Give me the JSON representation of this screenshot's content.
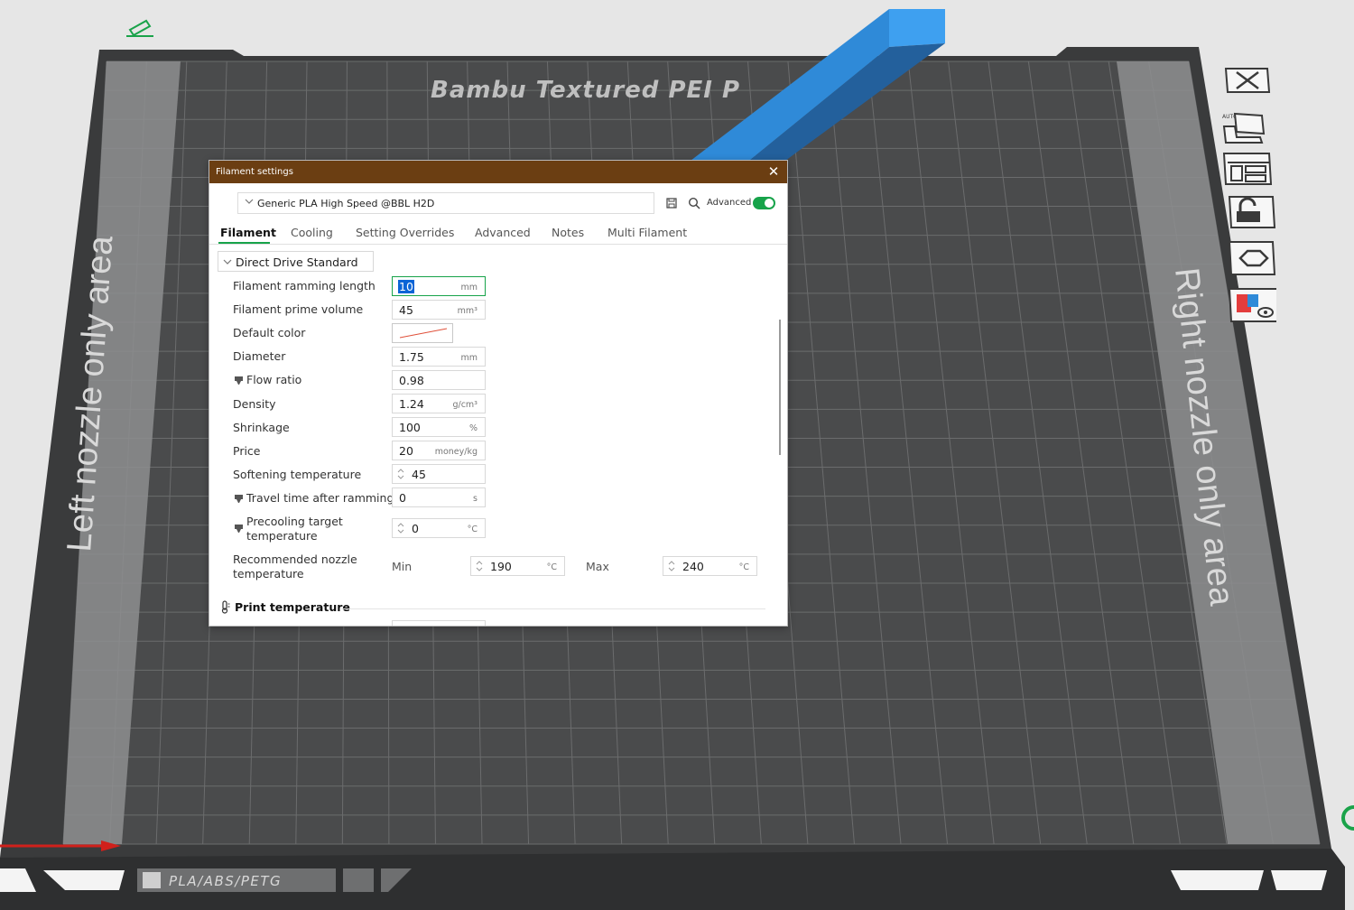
{
  "bed": {
    "plate_name": "Bambu Textured PEI P",
    "left_area_label": "Left nozzle only area",
    "right_area_label": "Right nozzle only area",
    "filament_tag": "PLA/ABS/PETG"
  },
  "side_toolbar": {
    "auto_label": "AUTO",
    "icons": [
      "close-icon",
      "auto-orient-icon",
      "arrange-icon",
      "lock-icon",
      "hexagon-icon",
      "filament-view-icon"
    ]
  },
  "dialog": {
    "title": "Filament settings",
    "preset": "Generic PLA High Speed @BBL H2D",
    "advanced_label": "Advanced",
    "advanced_on": true,
    "tabs": [
      {
        "label": "Filament",
        "active": true
      },
      {
        "label": "Cooling"
      },
      {
        "label": "Setting Overrides"
      },
      {
        "label": "Advanced"
      },
      {
        "label": "Notes"
      },
      {
        "label": "Multi Filament"
      }
    ],
    "group": "Direct Drive Standard",
    "fields": {
      "ramming_length": {
        "label": "Filament ramming length",
        "value": "10",
        "unit": "mm"
      },
      "prime_volume": {
        "label": "Filament prime volume",
        "value": "45",
        "unit": "mm³"
      },
      "default_color": {
        "label": "Default color"
      },
      "diameter": {
        "label": "Diameter",
        "value": "1.75",
        "unit": "mm"
      },
      "flow_ratio": {
        "label": "Flow ratio",
        "value": "0.98"
      },
      "density": {
        "label": "Density",
        "value": "1.24",
        "unit": "g/cm³"
      },
      "shrinkage": {
        "label": "Shrinkage",
        "value": "100",
        "unit": "%"
      },
      "price": {
        "label": "Price",
        "value": "20",
        "unit": "money/kg"
      },
      "softening": {
        "label": "Softening temperature",
        "value": "45"
      },
      "travel_time": {
        "label": "Travel time after ramming",
        "value": "0",
        "unit": "s"
      },
      "precooling": {
        "label1": "Precooling target",
        "label2": "temperature",
        "value": "0",
        "unit": "°C"
      },
      "nozzle_temp": {
        "label1": "Recommended nozzle",
        "label2": "temperature",
        "min_label": "Min",
        "min_value": "190",
        "max_label": "Max",
        "max_value": "240",
        "unit": "°C"
      }
    },
    "section_print_temperature": "Print temperature"
  }
}
